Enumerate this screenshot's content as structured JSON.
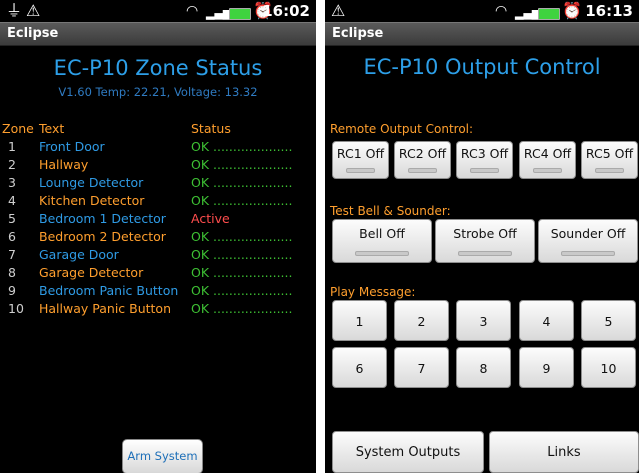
{
  "left": {
    "status_bar": {
      "time": "16:02"
    },
    "app_title": "Eclipse",
    "heading": "EC-P10 Zone Status",
    "info": "V1.60 Temp: 22.21, Voltage: 13.32",
    "headers": {
      "zone": "Zone",
      "text": "Text",
      "status": "Status"
    },
    "zones": [
      {
        "num": "1",
        "text": "Front Door",
        "status": "OK ....................",
        "text_color": "blue",
        "status_color": "green"
      },
      {
        "num": "2",
        "text": "Hallway",
        "status": "OK ....................",
        "text_color": "orange",
        "status_color": "green"
      },
      {
        "num": "3",
        "text": "Lounge Detector",
        "status": "OK ....................",
        "text_color": "blue",
        "status_color": "green"
      },
      {
        "num": "4",
        "text": "Kitchen Detector",
        "status": "OK ....................",
        "text_color": "orange",
        "status_color": "green"
      },
      {
        "num": "5",
        "text": "Bedroom 1 Detector",
        "status": "Active",
        "text_color": "blue",
        "status_color": "red"
      },
      {
        "num": "6",
        "text": "Bedroom 2 Detector",
        "status": "OK ....................",
        "text_color": "orange",
        "status_color": "green"
      },
      {
        "num": "7",
        "text": "Garage Door",
        "status": "OK ....................",
        "text_color": "blue",
        "status_color": "green"
      },
      {
        "num": "8",
        "text": "Garage Detector",
        "status": "OK ....................",
        "text_color": "orange",
        "status_color": "green"
      },
      {
        "num": "9",
        "text": "Bedroom Panic Button",
        "status": "OK ....................",
        "text_color": "blue",
        "status_color": "green"
      },
      {
        "num": "10",
        "text": "Hallway Panic Button",
        "status": "OK ....................",
        "text_color": "orange",
        "status_color": "green"
      }
    ],
    "arm_button": "Arm System"
  },
  "right": {
    "status_bar": {
      "time": "16:13"
    },
    "app_title": "Eclipse",
    "heading": "EC-P10 Output Control",
    "remote_label": "Remote Output Control:",
    "rc_buttons": [
      "RC1 Off",
      "RC2 Off",
      "RC3 Off",
      "RC4 Off",
      "RC5 Off"
    ],
    "test_label": "Test Bell & Sounder:",
    "bell_buttons": [
      "Bell Off",
      "Strobe Off",
      "Sounder Off"
    ],
    "play_label": "Play Message:",
    "message_buttons": [
      "1",
      "2",
      "3",
      "4",
      "5",
      "6",
      "7",
      "8",
      "9",
      "10"
    ],
    "bottom_buttons": [
      "System Outputs",
      "Links"
    ]
  },
  "colors": {
    "blue": "#2f9be5",
    "orange": "#ff9f2e",
    "green": "#3dbf33",
    "red": "#ff4d4d",
    "title_blue": "#2d9fe8"
  }
}
